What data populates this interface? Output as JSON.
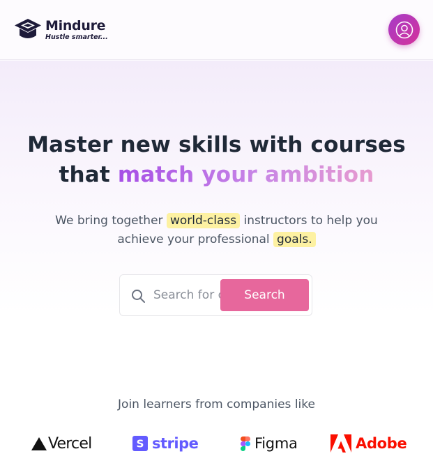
{
  "brand": {
    "name": "Mindure",
    "tagline": "Hustle smarter..."
  },
  "hero": {
    "headline_part1": "Master new skills with courses",
    "headline_part2": "that ",
    "headline_highlight": "match your ambition",
    "sub_part1": "We bring together ",
    "sub_mark1": "world-class",
    "sub_part2": " instructors to help you",
    "sub_part3": "achieve your professional ",
    "sub_mark2": "goals."
  },
  "search": {
    "placeholder": "Search for courses",
    "button_label": "Search"
  },
  "companies": {
    "title": "Join learners from companies like",
    "items": [
      {
        "name": "Vercel",
        "icon": "vercel-triangle-icon",
        "color": "#111111"
      },
      {
        "name": "stripe",
        "icon": "stripe-s-icon",
        "color": "#635bff"
      },
      {
        "name": "Figma",
        "icon": "figma-icon",
        "color": "#111111"
      },
      {
        "name": "Adobe",
        "icon": "adobe-icon",
        "color": "#fa0f00"
      }
    ]
  },
  "colors": {
    "accent_pink": "#e7679c",
    "avatar_gradient_start": "#a53cc8",
    "avatar_gradient_end": "#d5329a",
    "highlight": "#fdf1a2",
    "headline_gradient": [
      "#a64ee6",
      "#c886e6",
      "#e79bcf"
    ]
  }
}
